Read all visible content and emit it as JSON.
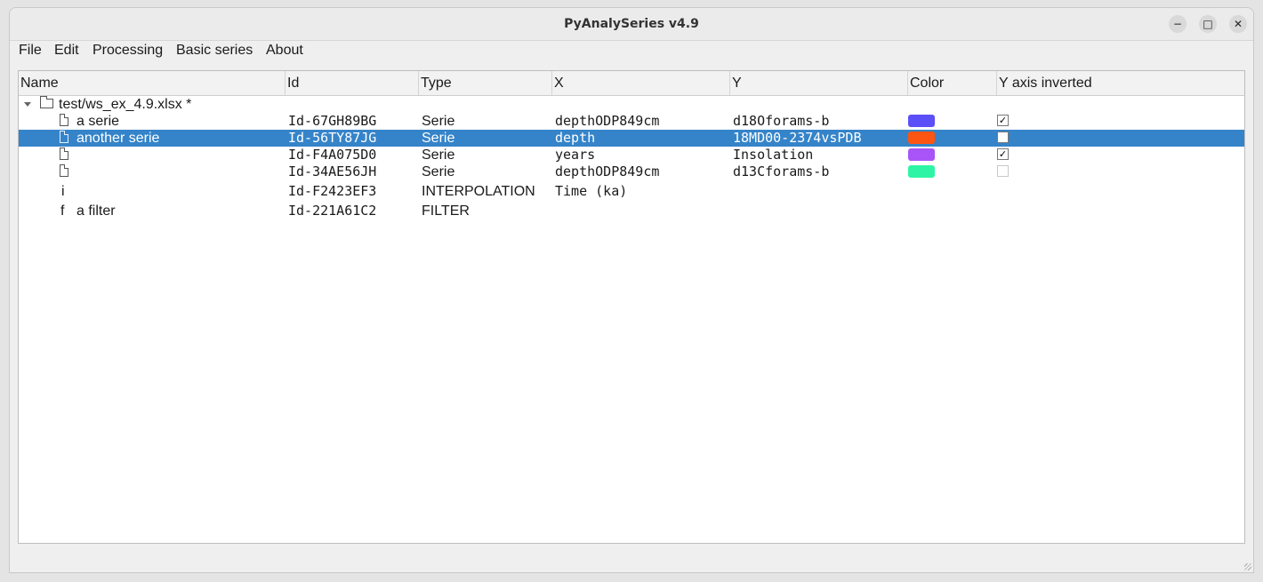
{
  "window": {
    "title": "PyAnalySeries v4.9"
  },
  "window_controls": {
    "minimize": "−",
    "maximize": "□",
    "close": "✕"
  },
  "menu": {
    "file": "File",
    "edit": "Edit",
    "processing": "Processing",
    "basic_series": "Basic series",
    "about": "About"
  },
  "columns": {
    "name": "Name",
    "id": "Id",
    "type": "Type",
    "x": "X",
    "y": "Y",
    "color": "Color",
    "y_inverted": "Y axis inverted"
  },
  "workspace": {
    "name": "test/ws_ex_4.9.xlsx *",
    "expanded": true
  },
  "rows": [
    {
      "icon": "file-icon",
      "name": "a serie",
      "id": "Id-67GH89BG",
      "type": "Serie",
      "x": "depthODP849cm",
      "y": "d18Oforams-b",
      "color": "#5b4ff7",
      "y_inverted": "✓",
      "selected": false
    },
    {
      "icon": "file-icon",
      "name": "another serie",
      "id": "Id-56TY87JG",
      "type": "Serie",
      "x": "depth",
      "y": "18MD00-2374vsPDB",
      "color": "#fd5512",
      "y_inverted": "",
      "selected": true
    },
    {
      "icon": "file-icon",
      "name": "",
      "id": "Id-F4A075D0",
      "type": "Serie",
      "x": "years",
      "y": "Insolation",
      "color": "#a855f7",
      "y_inverted": "✓",
      "selected": false
    },
    {
      "icon": "file-icon",
      "name": "",
      "id": "Id-34AE56JH",
      "type": "Serie",
      "x": "depthODP849cm",
      "y": "d13Cforams-b",
      "color": "#2ef5a5",
      "y_inverted": "",
      "selected": false
    },
    {
      "icon_glyph": "i",
      "name": "",
      "id": "Id-F2423EF3",
      "type": "INTERPOLATION",
      "x": "Time (ka)",
      "y": ""
    },
    {
      "icon_glyph": "f",
      "name": "a filter",
      "id": "Id-221A61C2",
      "type": "FILTER",
      "x": "",
      "y": ""
    }
  ]
}
